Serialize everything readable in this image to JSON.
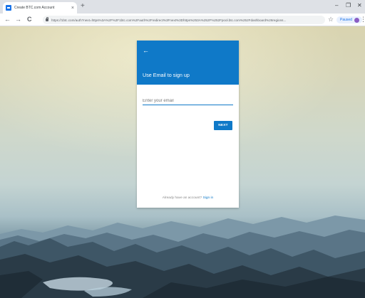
{
  "browser": {
    "tab_title": "Create BTC.com Account",
    "tab_close": "×",
    "new_tab": "+",
    "window_controls": {
      "minimize": "–",
      "restore": "❐",
      "close": "✕"
    },
    "nav": {
      "back": "←",
      "forward": "→",
      "reload": "C"
    },
    "url": "https://1btc.com/auth?next=https%3A%2F%2F1btc.com%2Fauth%2Fredirect%3Fnext%3Dhttps%253A%252F%252Fpool.btc.com%252Fdashboard%26regions...",
    "bookmark_icon": "☆",
    "profile_label": "Paused",
    "menu": "⋮",
    "accent_color": "#1a73e8"
  },
  "signup": {
    "back_arrow": "←",
    "title": "Use Email to sign up",
    "email_placeholder": "Enter your email",
    "email_value": "",
    "next_label": "NEXT",
    "footer_text": "Already have an account?",
    "signin_link": "Sign in",
    "brand_color": "#0f79c8"
  },
  "background": {
    "scene": "mountain-landscape"
  }
}
